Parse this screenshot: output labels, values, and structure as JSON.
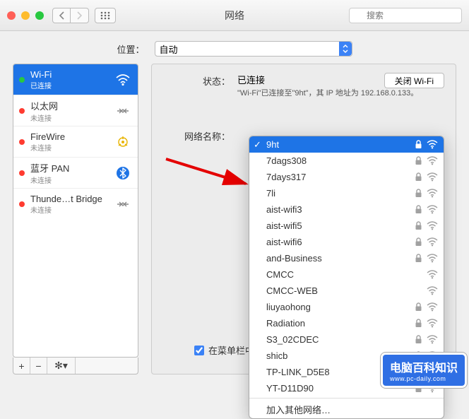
{
  "window": {
    "title": "网络",
    "search_placeholder": "搜索"
  },
  "location": {
    "label": "位置：",
    "value": "自动"
  },
  "sidebar": {
    "items": [
      {
        "title": "Wi-Fi",
        "sub": "已连接",
        "status": "green",
        "icon": "wifi",
        "selected": true
      },
      {
        "title": "以太网",
        "sub": "未连接",
        "status": "red",
        "icon": "ethernet"
      },
      {
        "title": "FireWire",
        "sub": "未连接",
        "status": "red",
        "icon": "firewire"
      },
      {
        "title": "蓝牙 PAN",
        "sub": "未连接",
        "status": "red",
        "icon": "bluetooth"
      },
      {
        "title": "Thunde…t Bridge",
        "sub": "未连接",
        "status": "red",
        "icon": "thunderbolt"
      }
    ],
    "toolbar": {
      "add": "+",
      "remove": "−",
      "gear": "✻▾"
    }
  },
  "detail": {
    "status_label": "状态：",
    "status_value": "已连接",
    "status_desc": "\"Wi-Fi\"已连接至\"9ht\"，其 IP 地址为 192.168.0.133。",
    "wifi_off": "关闭 Wi-Fi",
    "network_label": "网络名称：",
    "menubar_checkbox": "在菜单栏中显示 W"
  },
  "dropdown": {
    "selected": "9ht",
    "items": [
      {
        "name": "9ht",
        "lock": true,
        "selected": true
      },
      {
        "name": "7dags308",
        "lock": true
      },
      {
        "name": "7days317",
        "lock": true
      },
      {
        "name": "7li",
        "lock": true
      },
      {
        "name": "aist-wifi3",
        "lock": true
      },
      {
        "name": "aist-wifi5",
        "lock": true
      },
      {
        "name": "aist-wifi6",
        "lock": true
      },
      {
        "name": "and-Business",
        "lock": true
      },
      {
        "name": "CMCC",
        "lock": false
      },
      {
        "name": "CMCC-WEB",
        "lock": false
      },
      {
        "name": "liuyaohong",
        "lock": true
      },
      {
        "name": "Radiation",
        "lock": true
      },
      {
        "name": "S3_02CDEC",
        "lock": true
      },
      {
        "name": "shicb",
        "lock": true
      },
      {
        "name": "TP-LINK_D5E8",
        "lock": true
      },
      {
        "name": "YT-D11D90",
        "lock": true
      }
    ],
    "join_other": "加入其他网络…"
  },
  "watermark": {
    "main": "电脑百科知识",
    "sub": "www.pc-daily.com"
  }
}
